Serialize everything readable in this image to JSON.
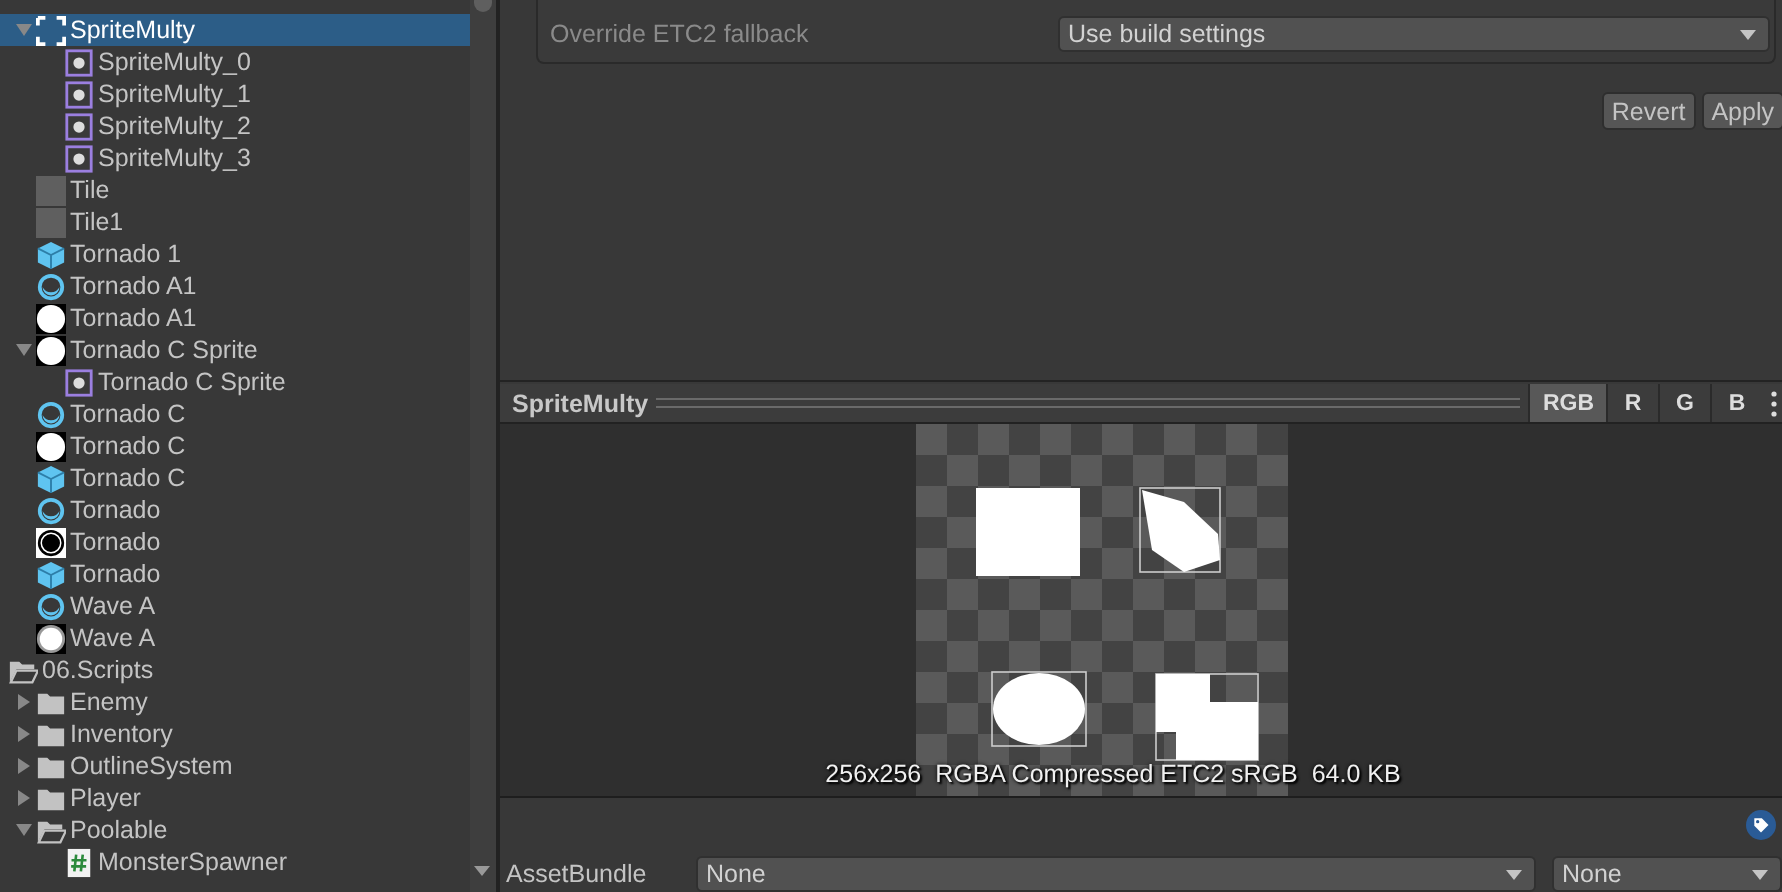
{
  "tree_above": [
    {
      "label": "SpriteMulty",
      "kind": "sprite-multi",
      "selected": true,
      "expanded": true,
      "children": [
        {
          "label": "SpriteMulty_0",
          "kind": "sprite"
        },
        {
          "label": "SpriteMulty_1",
          "kind": "sprite"
        },
        {
          "label": "SpriteMulty_2",
          "kind": "sprite"
        },
        {
          "label": "SpriteMulty_3",
          "kind": "sprite"
        }
      ]
    },
    {
      "label": "Tile",
      "kind": "tile"
    },
    {
      "label": "Tile1",
      "kind": "tile"
    },
    {
      "label": "Tornado 1",
      "kind": "prefab"
    },
    {
      "label": "Tornado A1",
      "kind": "animation"
    },
    {
      "label": "Tornado A1",
      "kind": "texture-blob"
    },
    {
      "label": "Tornado C Sprite",
      "kind": "texture-blob",
      "expanded": true,
      "children": [
        {
          "label": "Tornado C Sprite",
          "kind": "sprite"
        }
      ]
    },
    {
      "label": "Tornado C",
      "kind": "animation"
    },
    {
      "label": "Tornado C",
      "kind": "texture-blob"
    },
    {
      "label": "Tornado C",
      "kind": "prefab"
    },
    {
      "label": "Tornado",
      "kind": "animation"
    },
    {
      "label": "Tornado",
      "kind": "texture-ring"
    },
    {
      "label": "Tornado",
      "kind": "prefab"
    },
    {
      "label": "Wave A",
      "kind": "animation"
    },
    {
      "label": "Wave A",
      "kind": "texture-glow"
    }
  ],
  "tree": [
    {
      "label": "06.Scripts",
      "kind": "folder-open",
      "children": [
        {
          "label": "Enemy",
          "kind": "folder",
          "expanded": false
        },
        {
          "label": "Inventory",
          "kind": "folder",
          "expanded": false
        },
        {
          "label": "OutlineSystem",
          "kind": "folder",
          "expanded": false
        },
        {
          "label": "Player",
          "kind": "folder",
          "expanded": false
        },
        {
          "label": "Poolable",
          "kind": "folder-open",
          "expanded": true,
          "children": [
            {
              "label": "MonsterSpawner",
              "kind": "script"
            }
          ]
        }
      ]
    }
  ],
  "settings": [
    {
      "label": "Override ETC2 fallback",
      "value": "Use build settings"
    }
  ],
  "buttons": [
    "Revert",
    "Apply"
  ],
  "preview": {
    "title": "SpriteMulty",
    "channels": [
      {
        "label": "RGB",
        "selected": true
      },
      {
        "label": "R",
        "selected": false
      },
      {
        "label": "G",
        "selected": false
      },
      {
        "label": "B",
        "selected": false
      }
    ],
    "info": "256x256  RGBA Compressed ETC2 sRGB  64.0 KB"
  },
  "asset_bundle": {
    "label": "AssetBundle",
    "name": "None",
    "variant": "None"
  }
}
